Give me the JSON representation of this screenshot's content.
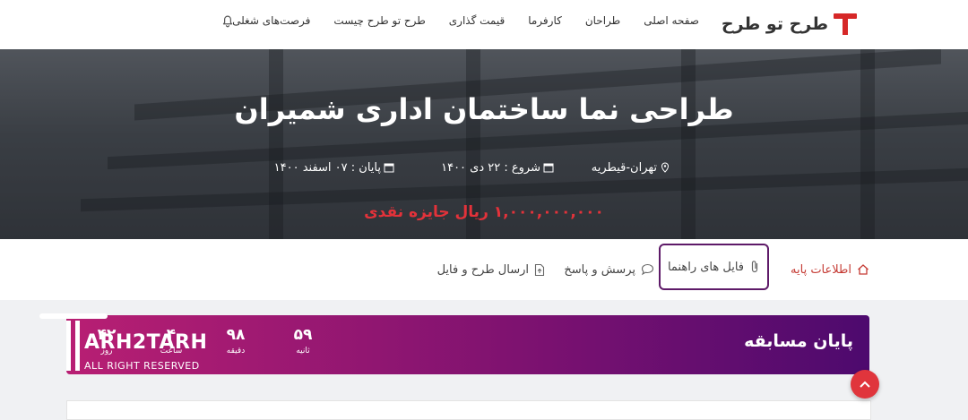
{
  "logo": {
    "text": "طرح تو طرح"
  },
  "nav": {
    "items": [
      {
        "label": "صفحه اصلی"
      },
      {
        "label": "طراحان"
      },
      {
        "label": "کارفرما"
      },
      {
        "label": "قیمت گذاری"
      },
      {
        "label": "طرح تو طرح چیست"
      },
      {
        "label": "فرصت‌های شغلی"
      }
    ],
    "bell_icon": "bell-icon"
  },
  "hero": {
    "title": "طراحی نما ساختمان اداری شمیران",
    "location": "تهران-قیطریه",
    "start": "شروع : ۲۲ دی ۱۴۰۰",
    "end": "پایان : ۰۷ اسفند ۱۴۰۰",
    "prize": "۱,۰۰۰,۰۰۰,۰۰۰ ریال جایزه نقدی",
    "prize_color": "#e3323a"
  },
  "tabs": [
    {
      "label": "اطلاعات پایه",
      "icon": "home-icon"
    },
    {
      "label": "فایل های راهنما",
      "icon": "paperclip-icon",
      "active": true
    },
    {
      "label": "پرسش و پاسخ",
      "icon": "chat-icon"
    },
    {
      "label": "ارسال طرح و فایل",
      "icon": "file-upload-icon"
    }
  ],
  "countdown": {
    "title": "پایان مسابقه",
    "units": [
      {
        "value": "۵۹",
        "label": "ثانیه"
      },
      {
        "value": "۹۸",
        "label": "دقیقه"
      },
      {
        "value": "۴",
        "label": "ساعت"
      },
      {
        "value": "۴۲",
        "label": "روز"
      }
    ]
  },
  "watermark": {
    "title": "ARH2TARH",
    "subtitle": "ALL RIGHT RESERVED"
  },
  "accent": "#5e1a68"
}
